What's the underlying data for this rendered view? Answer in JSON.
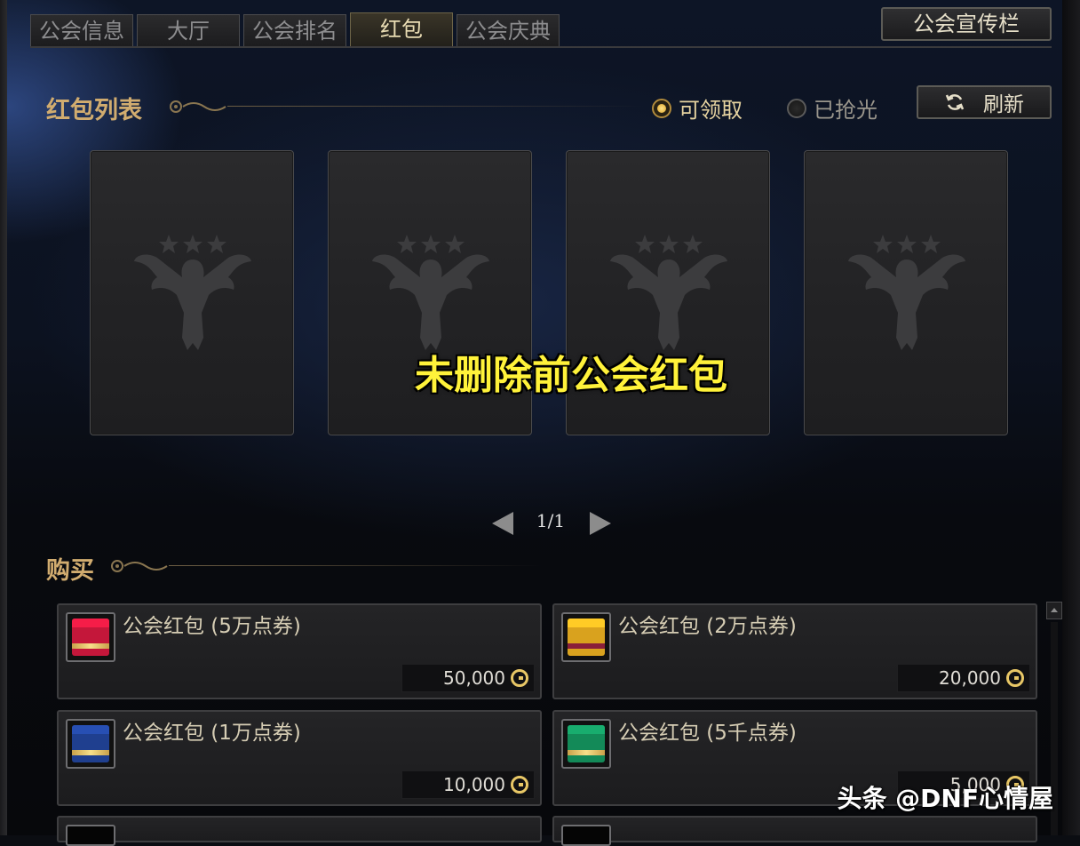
{
  "tabs": [
    {
      "label": "公会信息"
    },
    {
      "label": "大厅"
    },
    {
      "label": "公会排名"
    },
    {
      "label": "红包"
    },
    {
      "label": "公会庆典"
    }
  ],
  "active_tab": "红包",
  "promo_button": "公会宣传栏",
  "list_section": {
    "title": "红包列表",
    "filter_available": "可领取",
    "filter_empty": "已抢光",
    "filter_selected": "可领取",
    "refresh_label": "刷新",
    "card_count": 4
  },
  "overlay_caption": "未删除前公会红包",
  "pager": {
    "text": "1/1"
  },
  "buy_section": {
    "title": "购买",
    "items": [
      {
        "name": "公会红包 (5万点券)",
        "price": "50,000",
        "color": "#c4173a"
      },
      {
        "name": "公会红包 (2万点券)",
        "price": "20,000",
        "color": "#d9a21e"
      },
      {
        "name": "公会红包 (1万点券)",
        "price": "10,000",
        "color": "#1f3f8f"
      },
      {
        "name": "公会红包 (5千点券)",
        "price": "5,000",
        "color": "#138a58"
      }
    ]
  },
  "watermark": "头条 @DNF心情屋"
}
